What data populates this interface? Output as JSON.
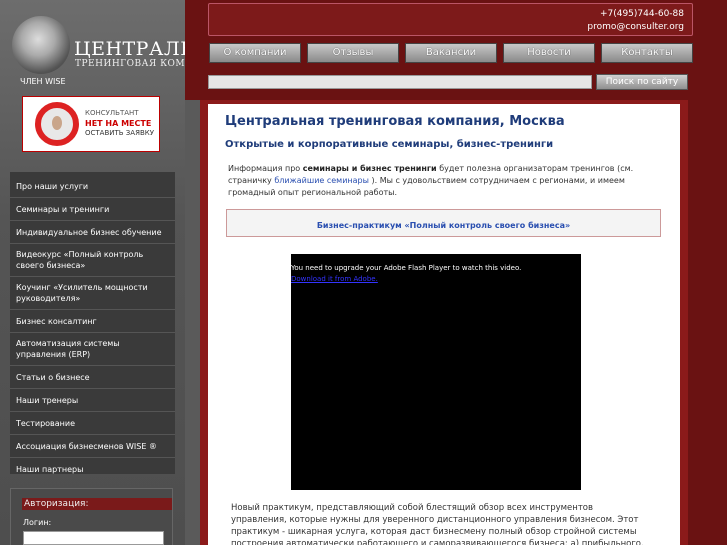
{
  "logo": {
    "name": "ЦЕНТРАЛЬНАЯ",
    "subtitle": "ТРЕНИНГОВАЯ КОМПАНИЯ",
    "member": "ЧЛЕН WISE"
  },
  "banner": {
    "line1": "КОНСУЛЬТАНТ",
    "line2": "НЕТ НА МЕСТЕ",
    "line3": "ОСТАВИТЬ ЗАЯВКУ"
  },
  "contacts": {
    "phone": "+7(495)744-60-88",
    "email": "promo@consulter.org"
  },
  "nav": [
    "О компании",
    "Отзывы",
    "Вакансии",
    "Новости",
    "Контакты"
  ],
  "search": {
    "button": "Поиск по сайту"
  },
  "sidebar": {
    "items": [
      "Про наши услуги",
      "Семинары и тренинги",
      "Индивидуальное бизнес обучение",
      "Видеокурс «Полный контроль своего бизнеса»",
      "Коучинг «Усилитель мощности руководителя»",
      "Бизнес консалтинг",
      "Автоматизация системы управления (ERP)",
      "Статьи о бизнесе",
      "Наши тренеры",
      "Тестирование",
      "Ассоциация бизнесменов WISE ®",
      "Наши партнеры"
    ]
  },
  "auth": {
    "title": "Авторизация:",
    "login_label": "Логин:"
  },
  "main": {
    "title": "Центральная тренинговая компания, Москва",
    "subtitle": "Открытые и корпоративные семинары, бизнес-тренинги",
    "intro_1": "Информация про ",
    "intro_bold": "семинары и бизнес тренинги",
    "intro_2": " будет полезна организаторам тренингов (см. страничку ",
    "intro_link": "ближайшие семинары",
    "intro_3": " ). Мы с удовольствием сотрудничаем с регионами, и имеем громадный опыт региональной работы.",
    "practicum_link": "Бизнес-практикум «Полный контроль своего бизнеса»",
    "flash_message": "You need to upgrade your Adobe Flash Player to watch this video.",
    "flash_link": "Download it from Adobe.",
    "description": "Новый практикум, представляющий собой блестящий обзор всех инструментов управления, которые нужны для уверенного дистанционного управления бизнесом.  Этот практикум - шикарная услуга, которая даст бизнесмену полный обзор стройной системы построения автоматически работающего и саморазвивающегося бизнеса: а) прибыльного, б) динамично растущего и  в) управляемого на"
  }
}
